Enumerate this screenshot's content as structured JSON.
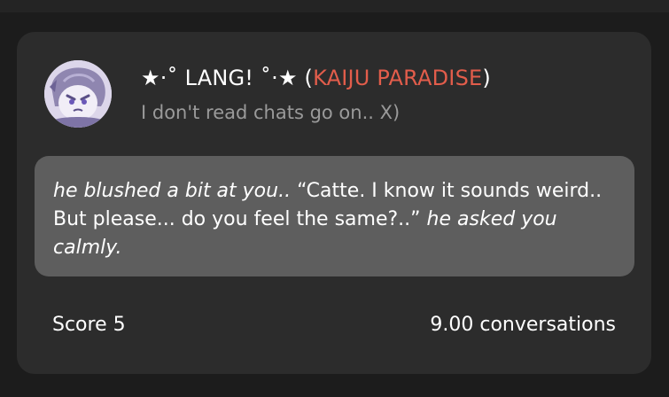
{
  "card": {
    "name_prefix": "★·˚ LANG! ˚·★ (",
    "name_tag": "KAIJU PARADISE",
    "name_suffix": ")",
    "subtitle": "I don't read chats go on.. X)",
    "avatar_icon": "character-avatar",
    "message": {
      "action_1": "he blushed a bit at you..",
      "speech": " “Catte. I know it sounds weird.. But please... do you feel the same?..” ",
      "action_2": "he asked you calmly."
    },
    "score_label": "Score 5",
    "conversations_label": "9.00 conversations"
  },
  "colors": {
    "page_background": "#1c1c1c",
    "card_background": "#2c2c2c",
    "bubble_background": "#5e5e5e",
    "tag_accent": "#e25d4b",
    "subtitle_text": "#9a9a9a"
  }
}
